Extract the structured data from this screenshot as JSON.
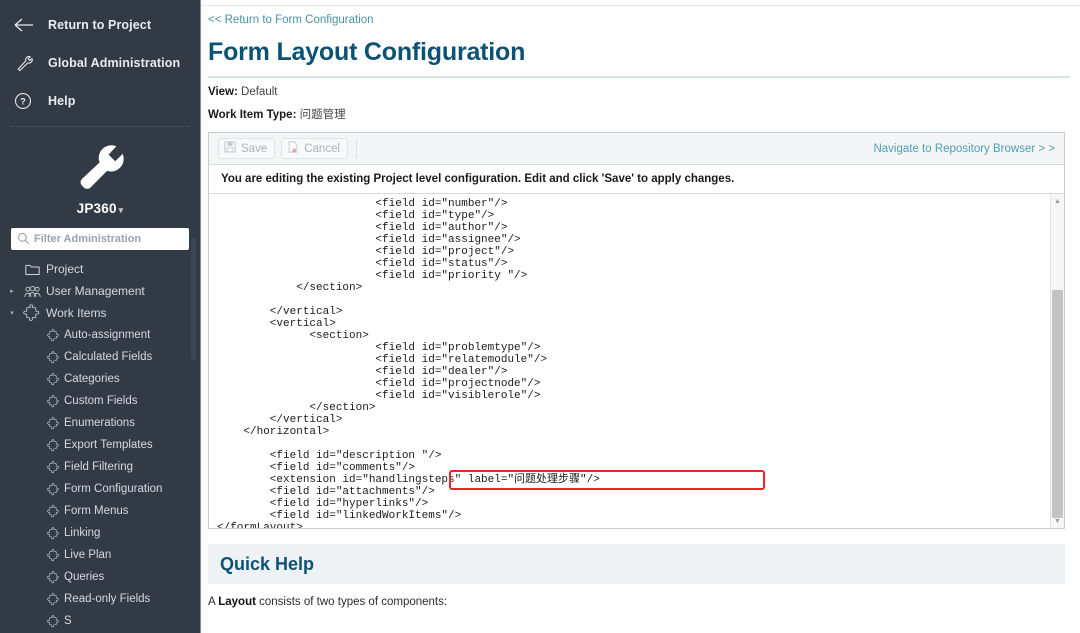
{
  "sidebar": {
    "top_links": [
      {
        "label": "Return to Project",
        "icon": "arrow-left-icon"
      },
      {
        "label": "Global Administration",
        "icon": "wrench-icon"
      },
      {
        "label": "Help",
        "icon": "question-circle-icon"
      }
    ],
    "brand": {
      "name": "JP360",
      "caret": "▾",
      "icon": "wrench-large-icon"
    },
    "filter": {
      "placeholder": "Filter Administration",
      "value": "",
      "icon": "search-icon"
    },
    "nav": [
      {
        "label": "Project",
        "level": 1,
        "icon": "folder-icon",
        "arrow": ""
      },
      {
        "label": "User Management",
        "level": 1,
        "icon": "users-icon",
        "arrow": "▸"
      },
      {
        "label": "Work Items",
        "level": 1,
        "icon": "puzzle-icon",
        "arrow": "▾"
      },
      {
        "label": "Auto-assignment",
        "level": 2,
        "icon": "puzzle-small-icon",
        "arrow": ""
      },
      {
        "label": "Calculated Fields",
        "level": 2,
        "icon": "puzzle-small-icon",
        "arrow": ""
      },
      {
        "label": "Categories",
        "level": 2,
        "icon": "puzzle-small-icon",
        "arrow": ""
      },
      {
        "label": "Custom Fields",
        "level": 2,
        "icon": "puzzle-small-icon",
        "arrow": ""
      },
      {
        "label": "Enumerations",
        "level": 2,
        "icon": "puzzle-small-icon",
        "arrow": ""
      },
      {
        "label": "Export Templates",
        "level": 2,
        "icon": "puzzle-small-icon",
        "arrow": ""
      },
      {
        "label": "Field Filtering",
        "level": 2,
        "icon": "puzzle-small-icon",
        "arrow": ""
      },
      {
        "label": "Form Configuration",
        "level": 2,
        "icon": "puzzle-small-icon",
        "arrow": ""
      },
      {
        "label": "Form Menus",
        "level": 2,
        "icon": "puzzle-small-icon",
        "arrow": ""
      },
      {
        "label": "Linking",
        "level": 2,
        "icon": "puzzle-small-icon",
        "arrow": ""
      },
      {
        "label": "Live Plan",
        "level": 2,
        "icon": "puzzle-small-icon",
        "arrow": ""
      },
      {
        "label": "Queries",
        "level": 2,
        "icon": "puzzle-small-icon",
        "arrow": ""
      },
      {
        "label": "Read-only Fields",
        "level": 2,
        "icon": "puzzle-small-icon",
        "arrow": ""
      },
      {
        "label": "S",
        "level": 2,
        "icon": "puzzle-small-icon",
        "arrow": ""
      }
    ]
  },
  "main": {
    "breadcrumb": "<< Return to Form Configuration",
    "page_title": "Form Layout Configuration",
    "meta": {
      "view_label": "View:",
      "view_value": "Default",
      "work_item_type_label": "Work Item Type:",
      "work_item_type_value": "问题管理"
    },
    "toolbar": {
      "save_label": "Save",
      "cancel_label": "Cancel",
      "navigate_link": "Navigate to Repository Browser > >"
    },
    "notice": "You are editing the existing Project level configuration. Edit and click 'Save' to apply changes.",
    "code": "                        <field id=\"number\"/>\n                        <field id=\"type\"/>\n                        <field id=\"author\"/>\n                        <field id=\"assignee\"/>\n                        <field id=\"project\"/>\n                        <field id=\"status\"/>\n                        <field id=\"priority \"/>\n            </section>\n\n        </vertical>\n        <vertical>\n              <section>\n                        <field id=\"problemtype\"/>\n                        <field id=\"relatemodule\"/>\n                        <field id=\"dealer\"/>\n                        <field id=\"projectnode\"/>\n                        <field id=\"visiblerole\"/>\n              </section>\n        </vertical>\n    </horizontal>\n\n        <field id=\"description \"/>\n        <field id=\"comments\"/>\n        <extension id=\"handlingsteps\" label=\"问题处理步骤\"/>\n        <field id=\"attachments\"/>\n        <field id=\"hyperlinks\"/>\n        <field id=\"linkedWorkItems\"/>\n</formLayout>",
    "highlight": {
      "line_text": "<extension id=\"handlingsteps\" label=\"问题处理步骤\"/>",
      "color": "#ee2222"
    },
    "scrollbar": {
      "up_arrow": "▲",
      "down_arrow": "▼"
    },
    "quick_help": {
      "title": "Quick Help",
      "text_prefix": "A ",
      "text_bold": "Layout",
      "text_suffix": " consists of two types of components:"
    }
  },
  "colors": {
    "sidebar_bg": "#323a45",
    "accent_title": "#0c5274",
    "link": "#4e9fb5",
    "highlight": "#ee2222"
  }
}
